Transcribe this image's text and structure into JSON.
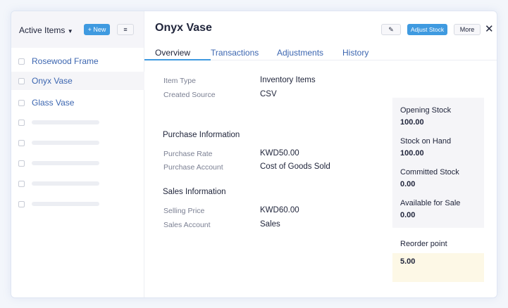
{
  "sidebar": {
    "filter_label": "Active Items",
    "new_label": "+ New",
    "items": [
      {
        "label": "Rosewood Frame"
      },
      {
        "label": "Onyx Vase",
        "selected": true
      },
      {
        "label": "Glass Vase"
      }
    ],
    "placeholder_rows": 5
  },
  "header": {
    "title": "Onyx Vase",
    "adjust_label": "Adjust Stock",
    "more_label": "More",
    "edit_icon": "pencil-icon",
    "close_icon": "close-icon"
  },
  "tabs": [
    {
      "label": "Overview",
      "active": true
    },
    {
      "label": "Transactions"
    },
    {
      "label": "Adjustments"
    },
    {
      "label": "History"
    }
  ],
  "details": {
    "item_type": {
      "label": "Item Type",
      "value": "Inventory Items"
    },
    "created_source": {
      "label": "Created Source",
      "value": "CSV"
    },
    "purchase_heading": "Purchase Information",
    "purchase_rate": {
      "label": "Purchase Rate",
      "value": "KWD50.00"
    },
    "purchase_account": {
      "label": "Purchase Account",
      "value": "Cost of Goods Sold"
    },
    "sales_heading": "Sales Information",
    "selling_price": {
      "label": "Selling Price",
      "value": "KWD60.00"
    },
    "sales_account": {
      "label": "Sales Account",
      "value": "Sales"
    }
  },
  "stock": {
    "opening": {
      "label": "Opening Stock",
      "value": "100.00"
    },
    "on_hand": {
      "label": "Stock on Hand",
      "value": "100.00"
    },
    "committed": {
      "label": "Committed Stock",
      "value": "0.00"
    },
    "available": {
      "label": "Available for Sale",
      "value": "0.00"
    },
    "reorder": {
      "label": "Reorder point",
      "value": "5.00"
    }
  },
  "colors": {
    "accent": "#3f9ae0",
    "link": "#3c66b0",
    "reorder_bg": "#fdf8e6"
  }
}
